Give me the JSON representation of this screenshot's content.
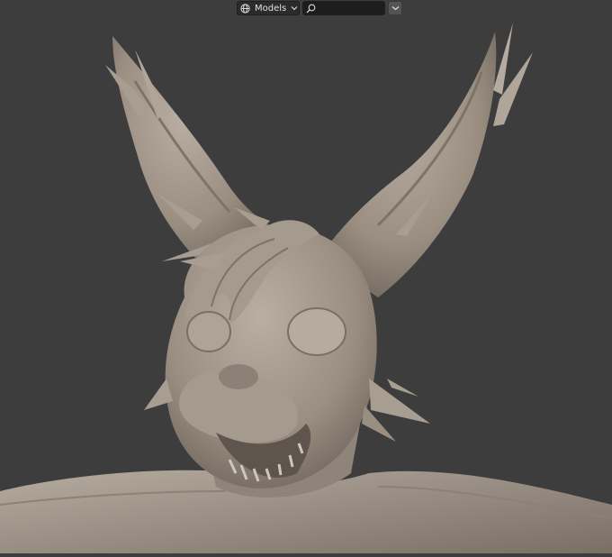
{
  "header": {
    "library_select": {
      "label": "Models",
      "icon": "globe-icon",
      "chevron": "chevron-down-icon"
    },
    "search": {
      "icon": "search-icon",
      "value": "",
      "placeholder": ""
    },
    "filter_button": {
      "icon": "chevron-down-icon"
    }
  },
  "viewport": {
    "background_color": "#3d3d3d",
    "model_color": "#9a8e81"
  }
}
